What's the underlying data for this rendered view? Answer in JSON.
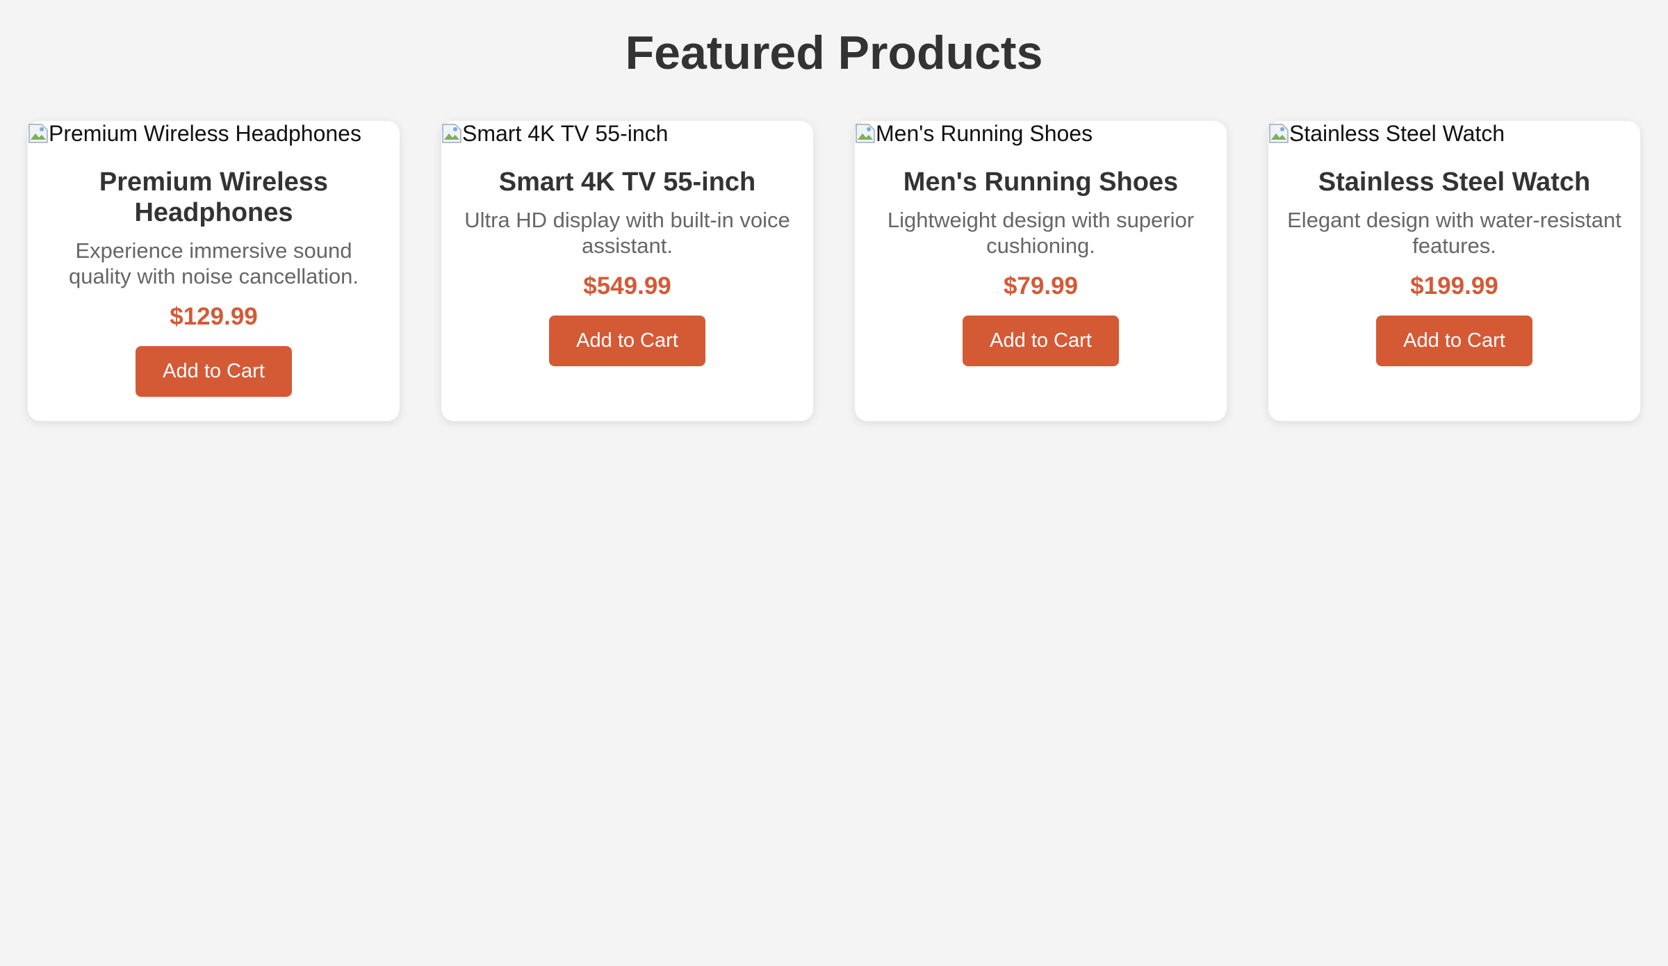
{
  "page": {
    "title": "Featured Products"
  },
  "colors": {
    "background": "#f4f4f4",
    "card": "#ffffff",
    "accent": "#d45a36",
    "title_text": "#333333",
    "description_text": "#666666"
  },
  "products": [
    {
      "image_alt": "Premium Wireless Headphones",
      "name": "Premium Wireless Headphones",
      "description": "Experience immersive sound quality with noise cancellation.",
      "price": "$129.99",
      "button_label": "Add to Cart",
      "icon": "broken-image-icon"
    },
    {
      "image_alt": "Smart 4K TV 55-inch",
      "name": "Smart 4K TV 55-inch",
      "description": "Ultra HD display with built-in voice assistant.",
      "price": "$549.99",
      "button_label": "Add to Cart",
      "icon": "broken-image-icon"
    },
    {
      "image_alt": "Men's Running Shoes",
      "name": "Men's Running Shoes",
      "description": "Lightweight design with superior cushioning.",
      "price": "$79.99",
      "button_label": "Add to Cart",
      "icon": "broken-image-icon"
    },
    {
      "image_alt": "Stainless Steel Watch",
      "name": "Stainless Steel Watch",
      "description": "Elegant design with water-resistant features.",
      "price": "$199.99",
      "button_label": "Add to Cart",
      "icon": "broken-image-icon"
    }
  ]
}
